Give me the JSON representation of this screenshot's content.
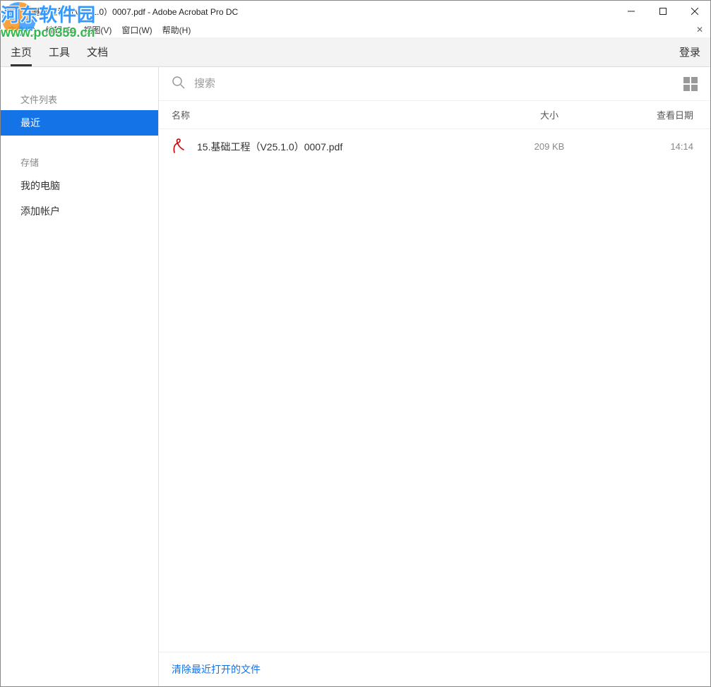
{
  "watermark": {
    "line1": "河东软件园",
    "line2": "www.pc0359.cn"
  },
  "titlebar": {
    "title": "15.基础工程（V25.1.0）0007.pdf - Adobe Acrobat Pro DC"
  },
  "menubar": {
    "items": [
      {
        "label": "文件(F)"
      },
      {
        "label": "编辑(E)"
      },
      {
        "label": "视图(V)"
      },
      {
        "label": "窗口(W)"
      },
      {
        "label": "帮助(H)"
      }
    ]
  },
  "tabbar": {
    "tabs": [
      {
        "label": "主页",
        "active": true
      },
      {
        "label": "工具",
        "active": false
      },
      {
        "label": "文档",
        "active": false
      }
    ],
    "login": "登录"
  },
  "sidebar": {
    "heading_files": "文件列表",
    "item_recent": "最近",
    "heading_storage": "存储",
    "item_mycomputer": "我的电脑",
    "item_addaccount": "添加帐户"
  },
  "search": {
    "placeholder": "搜索"
  },
  "list": {
    "col_name": "名称",
    "col_size": "大小",
    "col_date": "查看日期",
    "rows": [
      {
        "name": "15.基础工程（V25.1.0）0007.pdf",
        "size": "209 KB",
        "date": "14:14"
      }
    ]
  },
  "footer": {
    "clear_recent": "清除最近打开的文件"
  },
  "colors": {
    "accent": "#1473e6"
  }
}
